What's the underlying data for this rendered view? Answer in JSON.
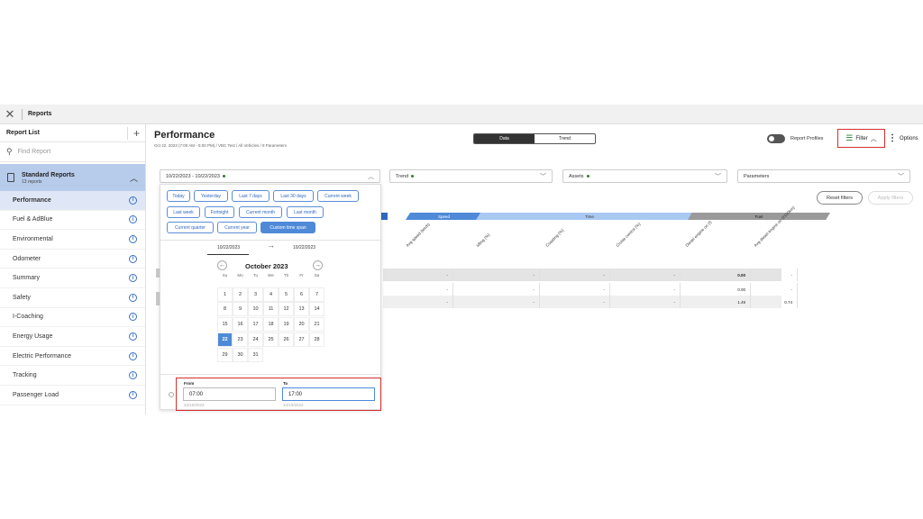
{
  "window": {
    "title": "Reports",
    "close_glyph": "✕"
  },
  "sidebar": {
    "header": "Report List",
    "add_glyph": "+",
    "search_placeholder": "Find Report",
    "group": {
      "title": "Standard Reports",
      "subtitle": "13 reports"
    },
    "items": [
      {
        "label": "Performance",
        "active": true
      },
      {
        "label": "Fuel & AdBlue"
      },
      {
        "label": "Environmental"
      },
      {
        "label": "Odometer"
      },
      {
        "label": "Summary"
      },
      {
        "label": "Safety"
      },
      {
        "label": "I-Coaching"
      },
      {
        "label": "Energy Usage"
      },
      {
        "label": "Electric Performance"
      },
      {
        "label": "Tracking"
      },
      {
        "label": "Passenger Load"
      }
    ]
  },
  "main": {
    "title": "Performance",
    "subtitle": "Oct 22, 2023 (7:00 AM - 5:00 PM) / VBC Test / All Vehicles / 8 Parameters",
    "view_toggle": {
      "data": "Data",
      "trend": "Trend"
    },
    "report_profiles": "Report Profiles",
    "filter": "Filter",
    "options": "Options",
    "dropdowns": {
      "date": "10/22/2023 - 10/22/2023",
      "trend": "Trend",
      "assets": "Assets",
      "parameters": "Parameters"
    },
    "reset_filters": "Reset filters",
    "apply_filters": "Apply filters",
    "categories": {
      "speed": "Speed",
      "time": "Time",
      "fuel": "Fuel"
    },
    "columns": [
      "Avg speed (km/h)",
      "Idling (%)",
      "Coasting (%)",
      "Cruise control (%)",
      "Diesel engine on (l)",
      "Avg diesel engine on (l/100km)"
    ],
    "rows": [
      [
        "-",
        "-",
        "-",
        "-",
        "0.00",
        "-"
      ],
      [
        "-",
        "-",
        "-",
        "-",
        "0.00",
        "-"
      ],
      [
        "-",
        "-",
        "-",
        "-",
        "1.49",
        "0.74"
      ]
    ]
  },
  "datepicker": {
    "presets": [
      "Today",
      "Yesterday",
      "Last 7 days",
      "Last 30 days",
      "Current week",
      "Last week",
      "Fortnight",
      "Current month",
      "Last month",
      "Current quarter",
      "Current year",
      "Custom time span"
    ],
    "selected_preset": "Custom time span",
    "range_start": "10/22/2023",
    "range_end": "10/22/2023",
    "month_label": "October 2023",
    "weekdays": [
      "Su",
      "Mo",
      "Tu",
      "We",
      "Th",
      "Fr",
      "Sa"
    ],
    "weeks": [
      [
        "",
        "",
        "",
        "",
        "",
        "",
        ""
      ],
      [
        "1",
        "2",
        "3",
        "4",
        "5",
        "6",
        "7"
      ],
      [
        "8",
        "9",
        "10",
        "11",
        "12",
        "13",
        "14"
      ],
      [
        "15",
        "16",
        "17",
        "18",
        "19",
        "20",
        "21"
      ],
      [
        "22",
        "23",
        "24",
        "25",
        "26",
        "27",
        "28"
      ],
      [
        "29",
        "30",
        "31",
        "",
        "",
        "",
        ""
      ]
    ],
    "selected_day": "22",
    "from_label": "From",
    "from_value": "07:00",
    "from_date": "22/10/2023",
    "to_label": "To",
    "to_value": "17:00",
    "to_date": "22/10/2023"
  }
}
